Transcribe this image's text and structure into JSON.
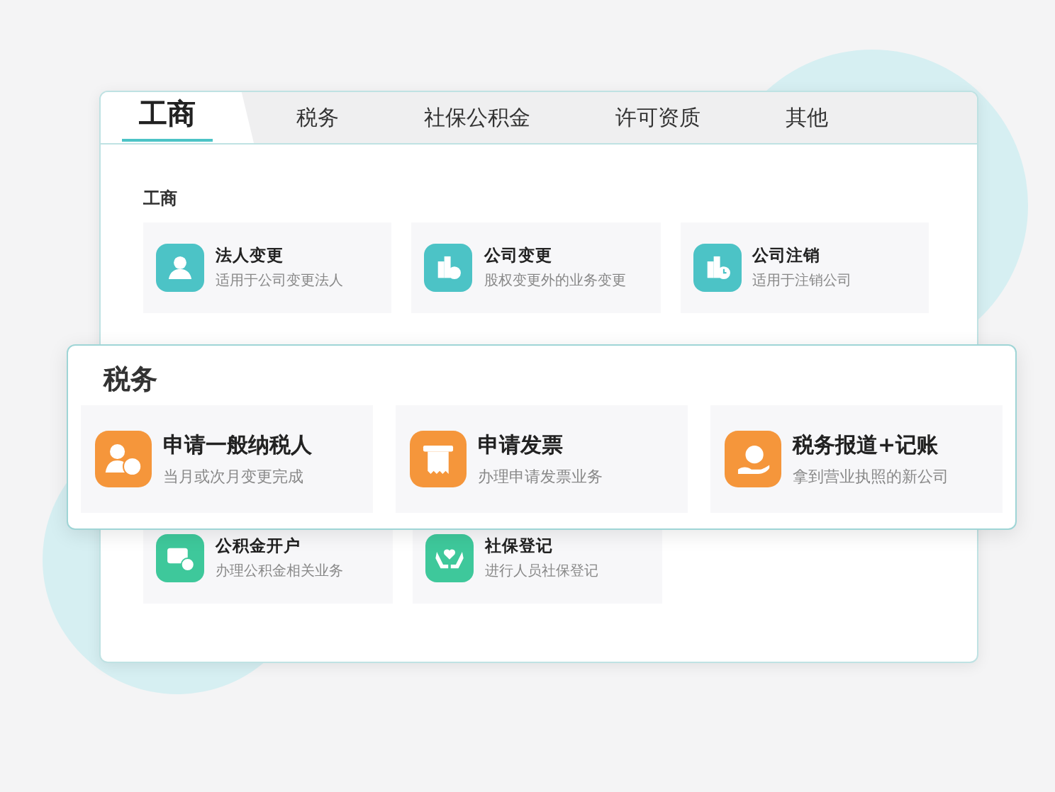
{
  "tabs": [
    {
      "label": "工商",
      "selected": true
    },
    {
      "label": "税务",
      "selected": false
    },
    {
      "label": "社保公积金",
      "selected": false
    },
    {
      "label": "许可资质",
      "selected": false
    },
    {
      "label": "其他",
      "selected": false
    }
  ],
  "business": {
    "kind": "teal",
    "heading": "工商",
    "items": [
      {
        "title": "法人变更",
        "subtitle": "适用于公司变更法人"
      },
      {
        "title": "公司变更",
        "subtitle": "股权变更外的业务变更"
      },
      {
        "title": "公司注销",
        "subtitle": "适用于注销公司"
      }
    ]
  },
  "social": {
    "kind": "green",
    "items": [
      {
        "title": "公积金开户",
        "subtitle": "办理公积金相关业务"
      },
      {
        "title": "社保登记",
        "subtitle": "进行人员社保登记"
      }
    ]
  },
  "tax_popup": {
    "kind": "orange",
    "heading": "税务",
    "items": [
      {
        "title": "申请一般纳税人",
        "subtitle": "当月或次月变更完成"
      },
      {
        "title": "申请发票",
        "subtitle": "办理申请发票业务"
      },
      {
        "title": "税务报道+记账",
        "subtitle": "拿到营业执照的新公司"
      }
    ]
  }
}
